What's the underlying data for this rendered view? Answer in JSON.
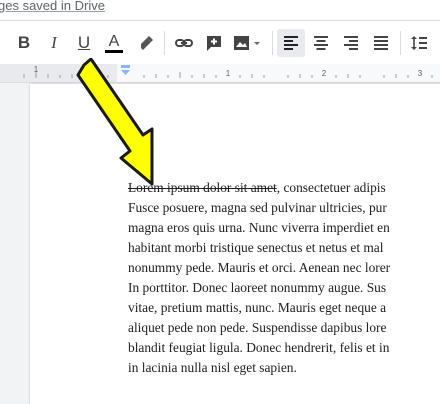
{
  "status": {
    "saved_text": "ges saved in Drive"
  },
  "toolbar": {
    "bold_label": "B",
    "italic_label": "I",
    "underline_label": "U",
    "text_color_label": "A",
    "icons": [
      "highlight-pen-icon",
      "link-icon",
      "insert-comment-icon",
      "insert-image-icon",
      "align-left-icon",
      "align-center-icon",
      "align-right-icon",
      "align-justify-icon",
      "line-spacing-icon"
    ],
    "colors": {
      "text_color_bar": "#000000",
      "active_bg": "#e8eaed"
    }
  },
  "document": {
    "strikethrough_text": "Lorem ipsum dolor sit amet",
    "lines": [
      ", consectetuer adipis",
      "Fusce posuere, magna sed pulvinar ultricies, pur",
      "magna eros quis urna. Nunc viverra imperdiet en",
      "habitant morbi tristique senectus et netus et mal",
      "nonummy pede. Mauris et orci. Aenean nec lorer",
      "In porttitor. Donec laoreet nonummy augue. Sus",
      "vitae, pretium mattis, nunc. Mauris eget neque a",
      "aliquet pede non pede. Suspendisse dapibus lore",
      "blandit feugiat ligula. Donec hendrerit, felis et in",
      "in lacinia nulla nisl eget sapien."
    ]
  },
  "annotation": {
    "arrow_color": "#ffff00",
    "arrow_outline": "#1a1a1a"
  }
}
